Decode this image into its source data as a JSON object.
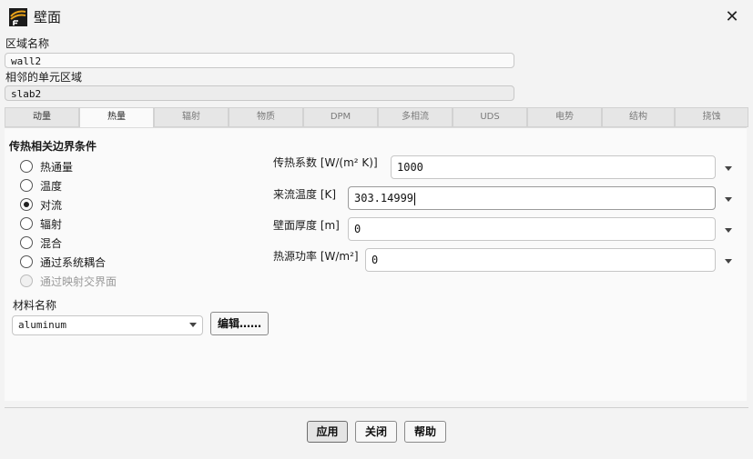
{
  "window": {
    "title": "壁面",
    "close_glyph": "✕"
  },
  "zone": {
    "name_label": "区域名称",
    "name_value": "wall2",
    "adjacent_label": "相邻的单元区域",
    "adjacent_value": "slab2"
  },
  "tabs": [
    {
      "label": "动量",
      "active": false
    },
    {
      "label": "热量",
      "active": true
    },
    {
      "label": "辐射",
      "active": false
    },
    {
      "label": "物质",
      "active": false
    },
    {
      "label": "DPM",
      "active": false
    },
    {
      "label": "多相流",
      "active": false
    },
    {
      "label": "UDS",
      "active": false
    },
    {
      "label": "电势",
      "active": false
    },
    {
      "label": "结构",
      "active": false
    },
    {
      "label": "挠蚀",
      "active": false
    }
  ],
  "thermal": {
    "group_title": "传热相关边界条件",
    "options": [
      {
        "label": "热通量",
        "checked": false,
        "enabled": true
      },
      {
        "label": "温度",
        "checked": false,
        "enabled": true
      },
      {
        "label": "对流",
        "checked": true,
        "enabled": true
      },
      {
        "label": "辐射",
        "checked": false,
        "enabled": true
      },
      {
        "label": "混合",
        "checked": false,
        "enabled": true
      },
      {
        "label": "通过系统耦合",
        "checked": false,
        "enabled": true
      },
      {
        "label": "通过映射交界面",
        "checked": false,
        "enabled": false
      }
    ],
    "properties": [
      {
        "label": "传热系数 [W/(m² K)]",
        "value": "1000"
      },
      {
        "label": "来流温度 [K]",
        "value": "303.14999"
      },
      {
        "label": "壁面厚度 [m]",
        "value": "0"
      },
      {
        "label": "热源功率 [W/m²]",
        "value": "0"
      }
    ],
    "material_label": "材料名称",
    "material_value": "aluminum",
    "edit_button": "编辑……"
  },
  "footer": {
    "apply": "应用",
    "close": "关闭",
    "help": "帮助"
  },
  "colors": {
    "window_bg": "#f3f3f3",
    "panel_bg": "#fafafa",
    "icon_bg": "#1b1b1b",
    "icon_accent": "#e8a21a"
  },
  "icons": [
    "fluent-app-icon",
    "close-icon",
    "radio-icon",
    "chevron-down-icon"
  ]
}
